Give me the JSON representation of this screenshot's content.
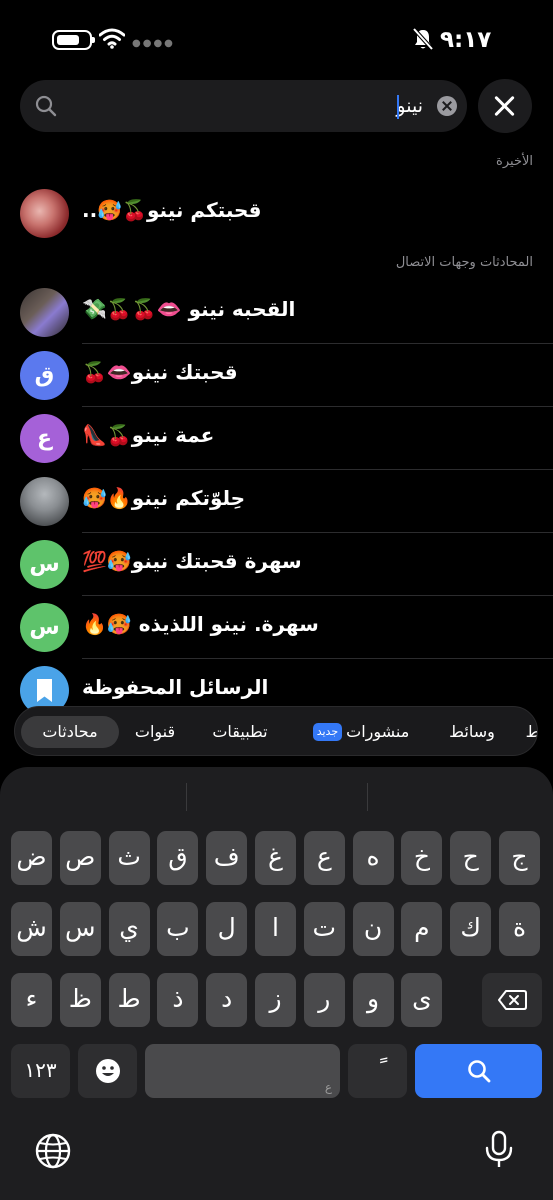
{
  "status_bar": {
    "time": "٩:١٧",
    "battery_level": 0.7
  },
  "search": {
    "value": "نينو",
    "placeholder": ""
  },
  "recent": {
    "title": "الأخيرة",
    "items": [
      {
        "name": "قحبتكم نينو🍒🥵..",
        "avatar": "photo-red"
      }
    ]
  },
  "contacts": {
    "title": "المحادثات وجهات الاتصال",
    "items": [
      {
        "name": "القحبه نينو 👄🍒🍒💸",
        "avatar": "photo-person"
      },
      {
        "name": "قحبتك نينو👄🍒",
        "avatar_letter": "ق",
        "avatar_color": "#5b79ee"
      },
      {
        "name": "عمة نينو🍒👠",
        "avatar_letter": "ع",
        "avatar_color": "#a561d8"
      },
      {
        "name": "حِلوّتكم نينو🔥🥵",
        "avatar": "photo-gray"
      },
      {
        "name": "سهرة قحبتك نينو🥵💯",
        "avatar_letter": "س",
        "avatar_color": "#5ec36b"
      },
      {
        "name": "سهرة. نينو اللذيذه 🥵🔥",
        "avatar_letter": "س",
        "avatar_color": "#5ec36b"
      },
      {
        "name": "الرسائل المحفوظة",
        "avatar": "bookmark-icon",
        "avatar_color": "#4aa3e8"
      }
    ]
  },
  "filters": {
    "tabs": [
      "محادثات",
      "قنوات",
      "تطبيقات",
      "منشورات",
      "وسائط",
      "ط"
    ],
    "new_badge": "جديد",
    "active": "محادثات"
  },
  "keyboard": {
    "row1": [
      "ض",
      "ص",
      "ث",
      "ق",
      "ف",
      "غ",
      "ع",
      "ه",
      "خ",
      "ح",
      "ج"
    ],
    "row2": [
      "ش",
      "س",
      "ي",
      "ب",
      "ل",
      "ا",
      "ت",
      "ن",
      "م",
      "ك",
      "ة"
    ],
    "row3": [
      "ء",
      "ظ",
      "ط",
      "ذ",
      "د",
      "ز",
      "ر",
      "و",
      "ى"
    ],
    "numbers_label": "١٢٣",
    "space_hint": "ع",
    "tanween_key": "ً",
    "accent_color": "#3478f6"
  }
}
